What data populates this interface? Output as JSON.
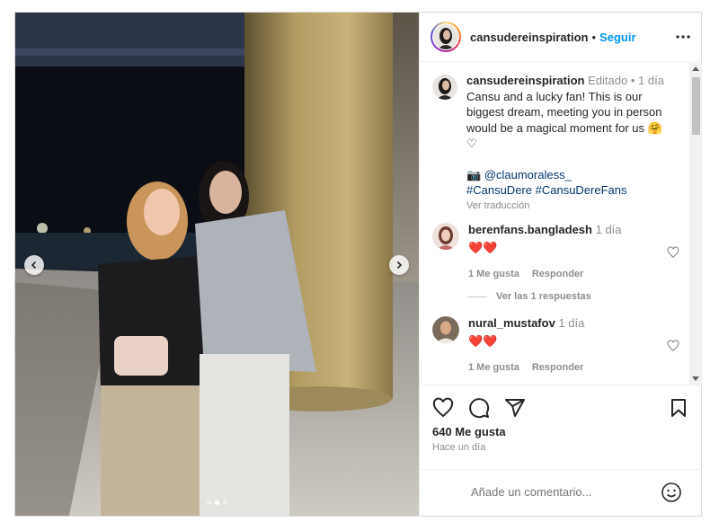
{
  "post": {
    "author": "cansudereinspiration",
    "follow_label": "Seguir",
    "separator": "•",
    "more_icon": "more-horizontal-icon",
    "caption": {
      "edited": "Editado",
      "time_ago": "1 día",
      "text": "Cansu and a lucky fan! This is our biggest dream, meeting you in person would be a magical moment for us 🤗 ♡",
      "camera_emoji": "📷",
      "mention": "@claumoraless_",
      "hashtag1": "#CansuDere",
      "hashtag2": "#CansuDereFans",
      "translate": "Ver traducción"
    },
    "comments": [
      {
        "user": "berenfans.bangladesh",
        "time": "1 día",
        "text": "❤️❤️",
        "likes_label": "1 Me gusta",
        "reply_label": "Responder",
        "view_replies": "Ver las 1 respuestas"
      },
      {
        "user": "nural_mustafov",
        "time": "1 día",
        "text": "❤️❤️",
        "likes_label": "1 Me gusta",
        "reply_label": "Responder"
      }
    ],
    "likes": "640 Me gusta",
    "posted": "Hace un día",
    "add_comment_placeholder": "Añade un comentario...",
    "carousel": {
      "count": 3,
      "active_index": 1
    }
  },
  "colors": {
    "accent": "#0095f6",
    "heart": "#e41e3f",
    "muted": "#8e8e8e",
    "link": "#00376b"
  }
}
